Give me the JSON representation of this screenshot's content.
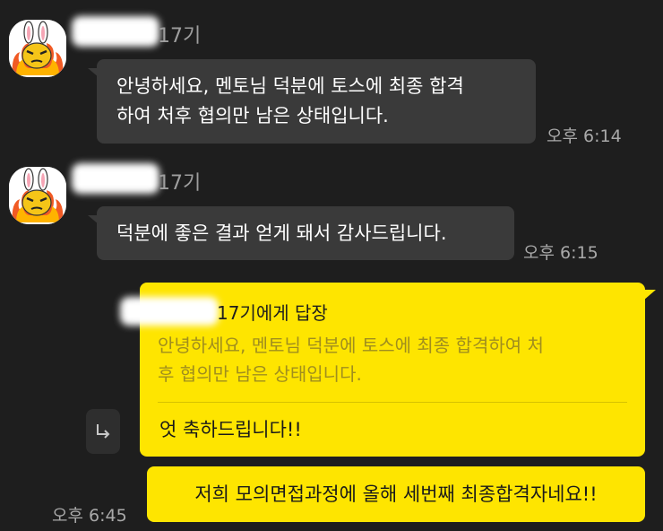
{
  "messages": [
    {
      "sender_suffix": "17기",
      "text_line1": "안녕하세요, 멘토님 덕분에 토스에 최종 합격",
      "text_line2": "하여 처후 협의만 남은 상태입니다.",
      "time": "오후 6:14"
    },
    {
      "sender_suffix": "17기",
      "text": "덕분에 좋은 결과 얻게 돼서 감사드립니다.",
      "time": "오후 6:15"
    }
  ],
  "reply": {
    "reply_to": "17기에게 답장",
    "quoted_line1": "안녕하세요, 멘토님 덕분에 토스에 최종 합격하여 처",
    "quoted_line2": "후 협의만 남은 상태입니다.",
    "text": "엇 축하드립니다!!",
    "arrow_icon": "reply-arrow-icon"
  },
  "outgoing": {
    "text": "저희 모의면접과정에 올해 세번째 최종합격자네요!!",
    "time": "오후 6:45"
  },
  "colors": {
    "background": "#1e1e1e",
    "incoming_bubble": "#3a3a3a",
    "outgoing_bubble": "#fee500"
  }
}
